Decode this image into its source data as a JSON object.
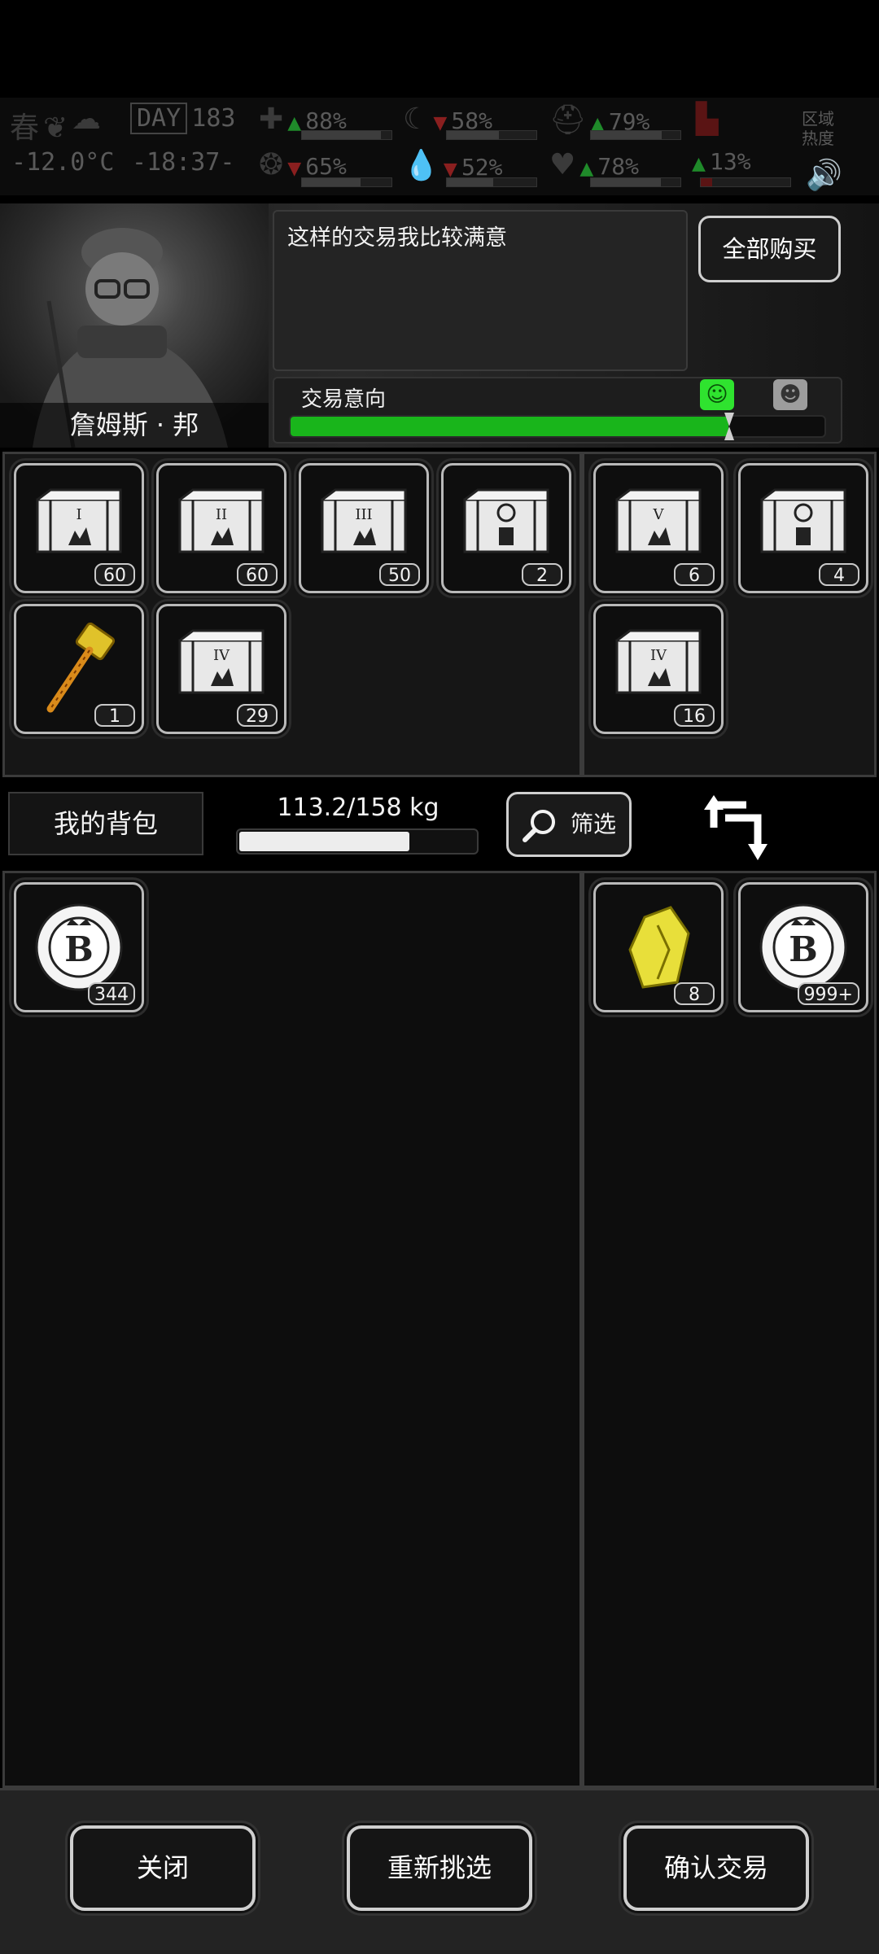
{
  "status": {
    "season": "春",
    "temperature": "-12.0°C",
    "day_label": "DAY",
    "day_number": "183",
    "time": "-18:37-",
    "region_heat_label": "区域热度",
    "stats": [
      {
        "icon": "medkit-icon",
        "value": "88%",
        "trend": "up"
      },
      {
        "icon": "stomach-icon",
        "value": "58%",
        "trend": "down"
      },
      {
        "icon": "mask-icon",
        "value": "79%",
        "trend": "up"
      },
      {
        "icon": "brain-icon",
        "value": "65%",
        "trend": "down"
      },
      {
        "icon": "water-drop-icon",
        "value": "52%",
        "trend": "down"
      },
      {
        "icon": "heart-icon",
        "value": "78%",
        "trend": "up"
      },
      {
        "icon": "boot-icon",
        "value": "13%",
        "trend": "up"
      }
    ]
  },
  "npc": {
    "name": "詹姆斯 · 邦",
    "dialog": "这样的交易我比较满意"
  },
  "buy_all_label": "全部购买",
  "intent": {
    "label": "交易意向",
    "level": 0.82
  },
  "merchant_items": [
    {
      "icon": "crate-icon",
      "mark": "I",
      "count": "60"
    },
    {
      "icon": "crate-icon",
      "mark": "II",
      "count": "60"
    },
    {
      "icon": "crate-icon",
      "mark": "III",
      "count": "50"
    },
    {
      "icon": "crate-icon",
      "mark": "gear",
      "count": "2"
    },
    {
      "icon": "hammer-icon",
      "mark": "",
      "count": "1"
    },
    {
      "icon": "crate-icon",
      "mark": "IV",
      "count": "29"
    }
  ],
  "merchant_selected": [
    {
      "icon": "crate-icon",
      "mark": "V",
      "count": "6"
    },
    {
      "icon": "crate-icon",
      "mark": "gear",
      "count": "4"
    },
    {
      "icon": "crate-icon",
      "mark": "IV",
      "count": "16"
    }
  ],
  "bag": {
    "label": "我的背包",
    "weight": "113.2/158 kg",
    "weight_level": 0.72,
    "filter_label": "筛选"
  },
  "player_items": [
    {
      "icon": "coin-icon",
      "count": "344"
    }
  ],
  "player_selected": [
    {
      "icon": "crystal-icon",
      "count": "8"
    },
    {
      "icon": "coin-icon",
      "count": "999+"
    }
  ],
  "buttons": {
    "close": "关闭",
    "reselect": "重新挑选",
    "confirm": "确认交易"
  },
  "colors": {
    "intent_fill": "#19b51b",
    "happy_face": "#2fe32f"
  }
}
